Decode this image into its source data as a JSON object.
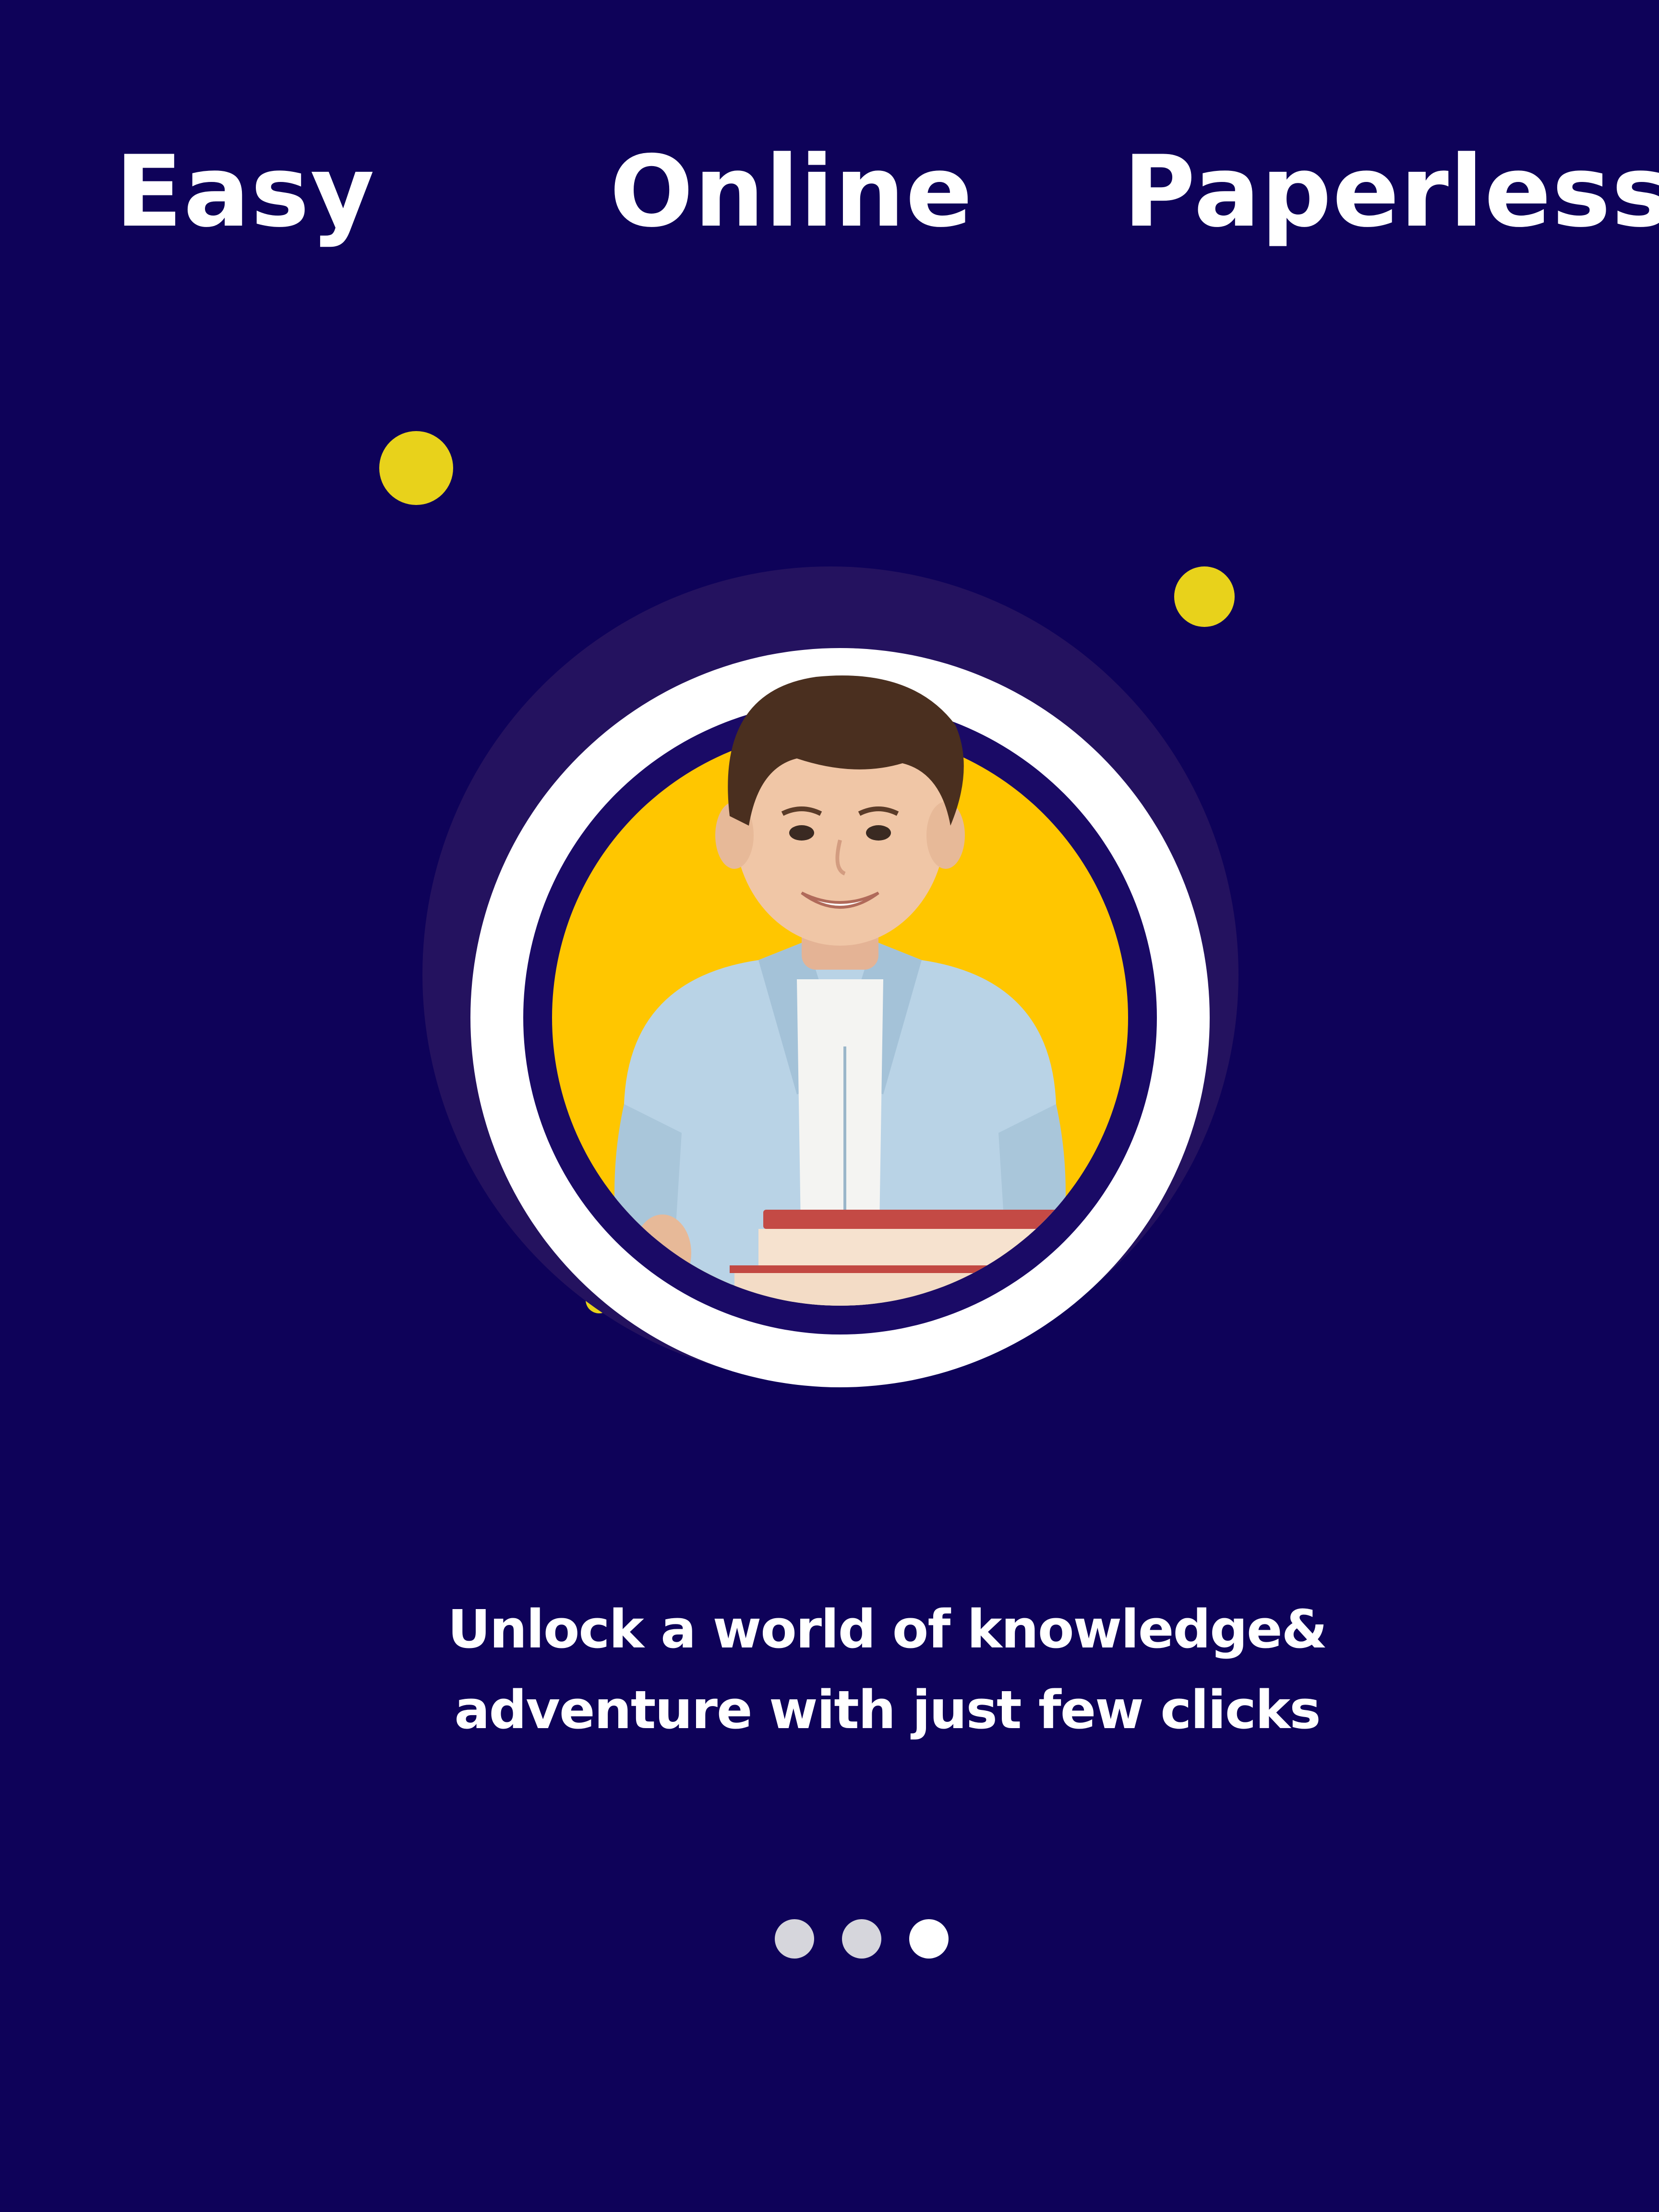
{
  "features": [
    "Easy",
    "Online",
    "Paperless"
  ],
  "tagline": {
    "line1": "Unlock a world of knowledge&",
    "line2": "adventure with just few clicks"
  },
  "pager": {
    "total": 3,
    "active_index": 2
  },
  "colors": {
    "background": "#0e0259",
    "accent_dot": "#e8d21b",
    "hero_fill": "#ffc600",
    "text": "#ffffff",
    "pager_inactive": "#d6d6dc",
    "pager_active": "#ffffff"
  },
  "hero": {
    "icon": "student-holding-books-illustration"
  }
}
